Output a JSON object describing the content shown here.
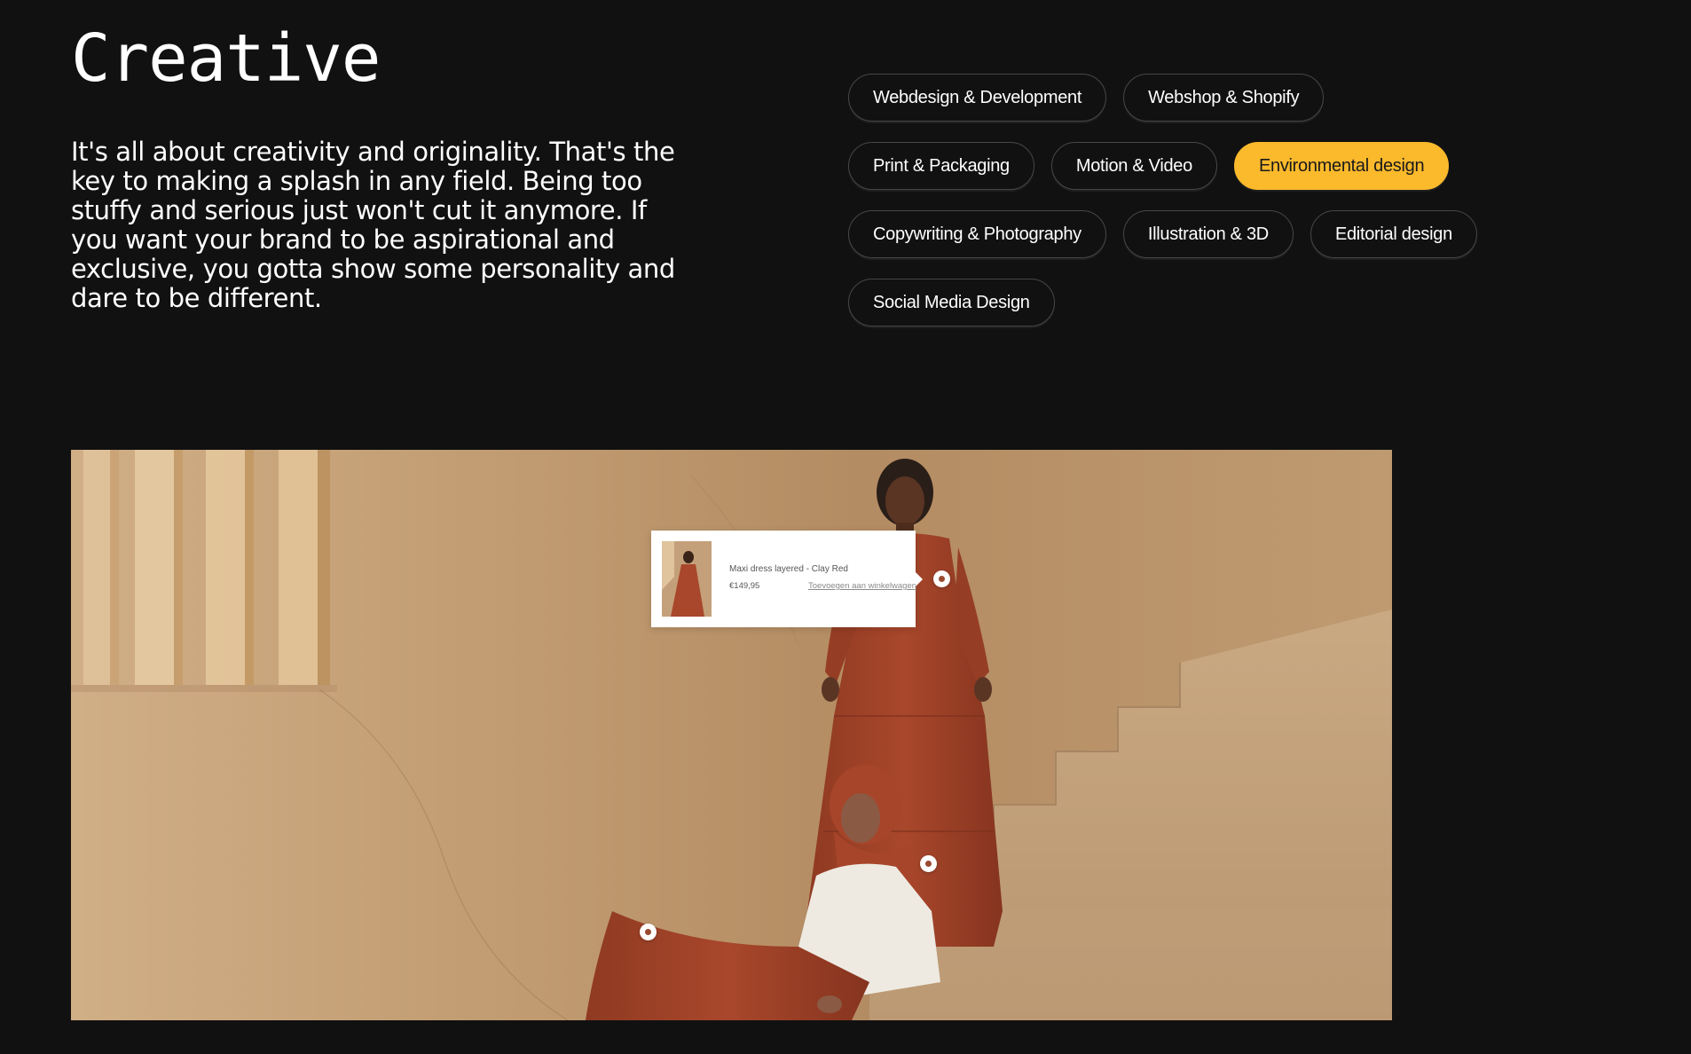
{
  "header": {
    "title": "Creative",
    "intro": "It's all about creativity and originality. That's the key to making a splash in any field. Being too stuffy and serious just won't cut it anymore. If you want your brand to be aspirational and exclusive, you gotta show some personality and dare to be different."
  },
  "tags": [
    {
      "label": "Webdesign & Development",
      "active": false
    },
    {
      "label": "Webshop & Shopify",
      "active": false
    },
    {
      "label": "Print & Packaging",
      "active": false
    },
    {
      "label": "Motion & Video",
      "active": false
    },
    {
      "label": "Environmental design",
      "active": true
    },
    {
      "label": "Copywriting & Photography",
      "active": false
    },
    {
      "label": "Illustration & 3D",
      "active": false
    },
    {
      "label": "Editorial design",
      "active": false
    },
    {
      "label": "Social Media Design",
      "active": false
    }
  ],
  "product_card": {
    "name": "Maxi dress layered - Clay Red",
    "price": "€149,95",
    "add_to_cart": "Toevoegen aan winkelwagen"
  },
  "colors": {
    "background": "#111111",
    "accent": "#fbb92c",
    "tag_border": "#474747",
    "dress": "#a8472b"
  }
}
